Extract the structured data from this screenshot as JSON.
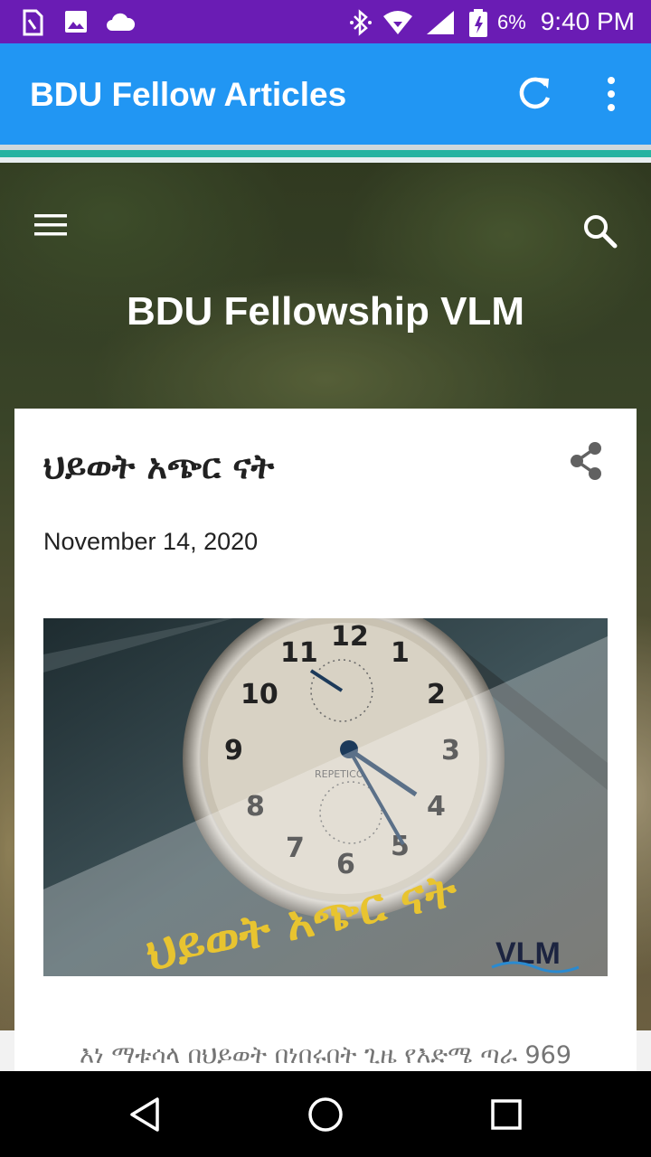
{
  "status_bar": {
    "time": "9:40 PM",
    "battery": "6%",
    "icons": [
      "sim-icon",
      "image-icon",
      "cloud-icon",
      "bluetooth-icon",
      "wifi-icon",
      "signal-icon",
      "battery-icon"
    ]
  },
  "app_bar": {
    "title": "BDU Fellow Articles",
    "color": "#2196f3",
    "actions": [
      "refresh-icon",
      "more-vert-icon"
    ]
  },
  "blog": {
    "title": "BDU Fellowship VLM",
    "header_icons": [
      "menu-icon",
      "search-icon"
    ]
  },
  "post": {
    "title": "ህይወት አጭር ናት",
    "date": "November 14, 2020",
    "image": {
      "overlay_text": "ህይወት አጭር ናት",
      "logo_text": "VLM",
      "clock_numbers": [
        "12",
        "1",
        "2",
        "3",
        "4",
        "5",
        "6",
        "7",
        "8",
        "9",
        "10",
        "11"
      ],
      "dial_text": "REPETICO"
    },
    "excerpt": "እነ ማቱሳላ በህይወት በነበሩበት ጊዜ የእድሜ ጣራ 969"
  },
  "nav_bar": {
    "buttons": [
      "back-icon",
      "home-icon",
      "recents-icon"
    ]
  }
}
